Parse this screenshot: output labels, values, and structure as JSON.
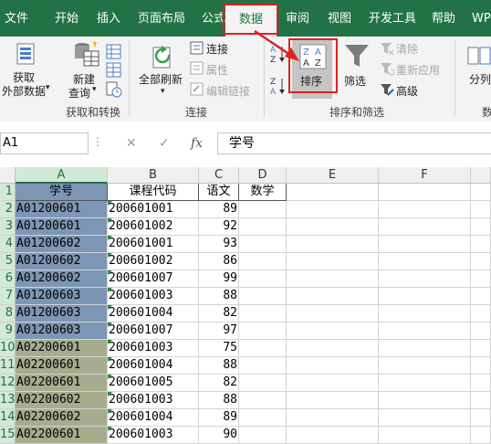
{
  "menu": {
    "tabs": [
      "文件",
      "开始",
      "插入",
      "页面布局",
      "公式",
      "数据",
      "审阅",
      "视图",
      "开发工具",
      "帮助",
      "WP"
    ],
    "active_tab": "数据"
  },
  "ribbon": {
    "get_data": {
      "line1": "获取",
      "line2": "外部数据"
    },
    "new_query": {
      "line1": "新建",
      "line2": "查询"
    },
    "group_get_transform": "获取和转换",
    "refresh_all": "全部刷新",
    "connections": "连接",
    "properties": "属性",
    "edit_links": "编辑链接",
    "group_connections": "连接",
    "sort": "排序",
    "filter": "筛选",
    "clear": "清除",
    "reapply": "重新应用",
    "advanced": "高级",
    "group_sort_filter": "排序和筛选",
    "split": "分列",
    "group_data_tools_partial": "数"
  },
  "formula_bar": {
    "name_box": "A1",
    "cancel_symbol": "✕",
    "enter_symbol": "✓",
    "fx_symbol": "fx",
    "formula_value": "学号"
  },
  "sheet": {
    "columns": [
      "A",
      "B",
      "C",
      "D",
      "E",
      "F"
    ],
    "row_numbers": [
      "1",
      "2",
      "3",
      "4",
      "5",
      "6",
      "7",
      "8",
      "9",
      "10",
      "11",
      "12",
      "13",
      "14",
      "15"
    ],
    "header_row": [
      "学号",
      "课程代码",
      "语文",
      "数学"
    ],
    "rows": [
      [
        "A01200601",
        "200601001",
        "89"
      ],
      [
        "A01200601",
        "200601002",
        "92"
      ],
      [
        "A01200602",
        "200601001",
        "93"
      ],
      [
        "A01200602",
        "200601002",
        "86"
      ],
      [
        "A01200602",
        "200601007",
        "99"
      ],
      [
        "A01200603",
        "200601003",
        "88"
      ],
      [
        "A01200603",
        "200601004",
        "82"
      ],
      [
        "A01200603",
        "200601007",
        "97"
      ],
      [
        "A02200601",
        "200601003",
        "75"
      ],
      [
        "A02200601",
        "200601004",
        "88"
      ],
      [
        "A02200601",
        "200601005",
        "82"
      ],
      [
        "A02200602",
        "200601003",
        "88"
      ],
      [
        "A02200602",
        "200601004",
        "89"
      ],
      [
        "A02200601",
        "200601003",
        "90"
      ]
    ],
    "colors": {
      "group1_fill": "#7e96b6",
      "group2_fill": "#a5ad8d",
      "header_fill": "#7e96b6",
      "accent": "#217346",
      "highlight_border": "#e02020"
    }
  }
}
